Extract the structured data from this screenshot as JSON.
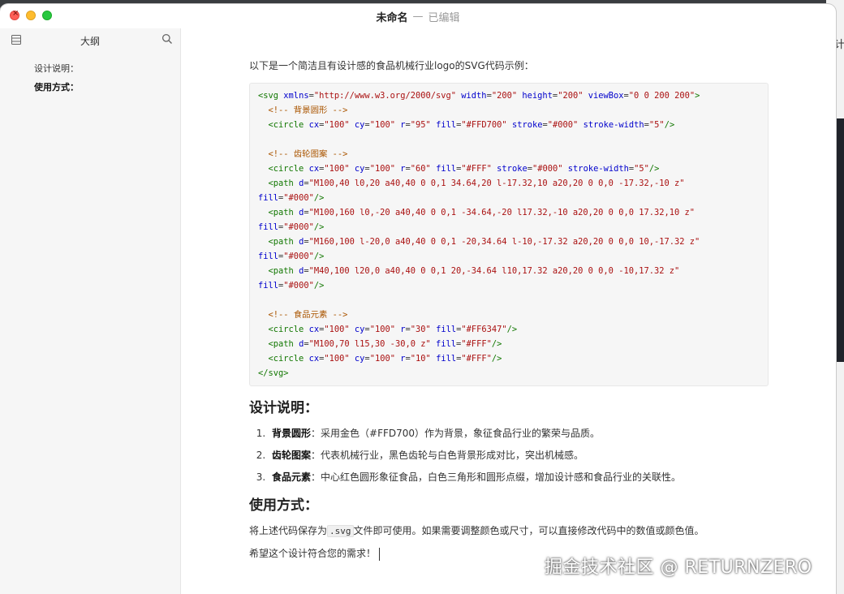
{
  "window": {
    "title": "未命名",
    "separator": "—",
    "status": "已编辑"
  },
  "sidebar": {
    "title": "大纲",
    "items": [
      {
        "label": "设计说明："
      },
      {
        "label": "使用方式："
      }
    ]
  },
  "document": {
    "intro": "以下是一个简洁且有设计感的食品机械行业logo的SVG代码示例：",
    "code_lines": [
      [
        {
          "t": "tag",
          "v": "<svg"
        },
        {
          "t": "p",
          "v": " "
        },
        {
          "t": "attr",
          "v": "xmlns"
        },
        {
          "t": "p",
          "v": "="
        },
        {
          "t": "str",
          "v": "\"http://www.w3.org/2000/svg\""
        },
        {
          "t": "p",
          "v": " "
        },
        {
          "t": "attr",
          "v": "width"
        },
        {
          "t": "p",
          "v": "="
        },
        {
          "t": "str",
          "v": "\"200\""
        },
        {
          "t": "p",
          "v": " "
        },
        {
          "t": "attr",
          "v": "height"
        },
        {
          "t": "p",
          "v": "="
        },
        {
          "t": "str",
          "v": "\"200\""
        },
        {
          "t": "p",
          "v": " "
        },
        {
          "t": "attr",
          "v": "viewBox"
        },
        {
          "t": "p",
          "v": "="
        },
        {
          "t": "str",
          "v": "\"0 0 200 200\""
        },
        {
          "t": "tag",
          "v": ">"
        }
      ],
      [
        {
          "t": "p",
          "v": "  "
        },
        {
          "t": "comment",
          "v": "<!-- 背景圆形 -->"
        }
      ],
      [
        {
          "t": "p",
          "v": "  "
        },
        {
          "t": "tag",
          "v": "<circle"
        },
        {
          "t": "p",
          "v": " "
        },
        {
          "t": "attr",
          "v": "cx"
        },
        {
          "t": "p",
          "v": "="
        },
        {
          "t": "str",
          "v": "\"100\""
        },
        {
          "t": "p",
          "v": " "
        },
        {
          "t": "attr",
          "v": "cy"
        },
        {
          "t": "p",
          "v": "="
        },
        {
          "t": "str",
          "v": "\"100\""
        },
        {
          "t": "p",
          "v": " "
        },
        {
          "t": "attr",
          "v": "r"
        },
        {
          "t": "p",
          "v": "="
        },
        {
          "t": "str",
          "v": "\"95\""
        },
        {
          "t": "p",
          "v": " "
        },
        {
          "t": "attr",
          "v": "fill"
        },
        {
          "t": "p",
          "v": "="
        },
        {
          "t": "str",
          "v": "\"#FFD700\""
        },
        {
          "t": "p",
          "v": " "
        },
        {
          "t": "attr",
          "v": "stroke"
        },
        {
          "t": "p",
          "v": "="
        },
        {
          "t": "str",
          "v": "\"#000\""
        },
        {
          "t": "p",
          "v": " "
        },
        {
          "t": "attr",
          "v": "stroke-width"
        },
        {
          "t": "p",
          "v": "="
        },
        {
          "t": "str",
          "v": "\"5\""
        },
        {
          "t": "tag",
          "v": "/>"
        }
      ],
      [],
      [
        {
          "t": "p",
          "v": "  "
        },
        {
          "t": "comment",
          "v": "<!-- 齿轮图案 -->"
        }
      ],
      [
        {
          "t": "p",
          "v": "  "
        },
        {
          "t": "tag",
          "v": "<circle"
        },
        {
          "t": "p",
          "v": " "
        },
        {
          "t": "attr",
          "v": "cx"
        },
        {
          "t": "p",
          "v": "="
        },
        {
          "t": "str",
          "v": "\"100\""
        },
        {
          "t": "p",
          "v": " "
        },
        {
          "t": "attr",
          "v": "cy"
        },
        {
          "t": "p",
          "v": "="
        },
        {
          "t": "str",
          "v": "\"100\""
        },
        {
          "t": "p",
          "v": " "
        },
        {
          "t": "attr",
          "v": "r"
        },
        {
          "t": "p",
          "v": "="
        },
        {
          "t": "str",
          "v": "\"60\""
        },
        {
          "t": "p",
          "v": " "
        },
        {
          "t": "attr",
          "v": "fill"
        },
        {
          "t": "p",
          "v": "="
        },
        {
          "t": "str",
          "v": "\"#FFF\""
        },
        {
          "t": "p",
          "v": " "
        },
        {
          "t": "attr",
          "v": "stroke"
        },
        {
          "t": "p",
          "v": "="
        },
        {
          "t": "str",
          "v": "\"#000\""
        },
        {
          "t": "p",
          "v": " "
        },
        {
          "t": "attr",
          "v": "stroke-width"
        },
        {
          "t": "p",
          "v": "="
        },
        {
          "t": "str",
          "v": "\"5\""
        },
        {
          "t": "tag",
          "v": "/>"
        }
      ],
      [
        {
          "t": "p",
          "v": "  "
        },
        {
          "t": "tag",
          "v": "<path"
        },
        {
          "t": "p",
          "v": " "
        },
        {
          "t": "attr",
          "v": "d"
        },
        {
          "t": "p",
          "v": "="
        },
        {
          "t": "str",
          "v": "\"M100,40 l0,20 a40,40 0 0,1 34.64,20 l-17.32,10 a20,20 0 0,0 -17.32,-10 z\""
        }
      ],
      [
        {
          "t": "attr",
          "v": "fill"
        },
        {
          "t": "p",
          "v": "="
        },
        {
          "t": "str",
          "v": "\"#000\""
        },
        {
          "t": "tag",
          "v": "/>"
        }
      ],
      [
        {
          "t": "p",
          "v": "  "
        },
        {
          "t": "tag",
          "v": "<path"
        },
        {
          "t": "p",
          "v": " "
        },
        {
          "t": "attr",
          "v": "d"
        },
        {
          "t": "p",
          "v": "="
        },
        {
          "t": "str",
          "v": "\"M100,160 l0,-20 a40,40 0 0,1 -34.64,-20 l17.32,-10 a20,20 0 0,0 17.32,10 z\""
        }
      ],
      [
        {
          "t": "attr",
          "v": "fill"
        },
        {
          "t": "p",
          "v": "="
        },
        {
          "t": "str",
          "v": "\"#000\""
        },
        {
          "t": "tag",
          "v": "/>"
        }
      ],
      [
        {
          "t": "p",
          "v": "  "
        },
        {
          "t": "tag",
          "v": "<path"
        },
        {
          "t": "p",
          "v": " "
        },
        {
          "t": "attr",
          "v": "d"
        },
        {
          "t": "p",
          "v": "="
        },
        {
          "t": "str",
          "v": "\"M160,100 l-20,0 a40,40 0 0,1 -20,34.64 l-10,-17.32 a20,20 0 0,0 10,-17.32 z\""
        }
      ],
      [
        {
          "t": "attr",
          "v": "fill"
        },
        {
          "t": "p",
          "v": "="
        },
        {
          "t": "str",
          "v": "\"#000\""
        },
        {
          "t": "tag",
          "v": "/>"
        }
      ],
      [
        {
          "t": "p",
          "v": "  "
        },
        {
          "t": "tag",
          "v": "<path"
        },
        {
          "t": "p",
          "v": " "
        },
        {
          "t": "attr",
          "v": "d"
        },
        {
          "t": "p",
          "v": "="
        },
        {
          "t": "str",
          "v": "\"M40,100 l20,0 a40,40 0 0,1 20,-34.64 l10,17.32 a20,20 0 0,0 -10,17.32 z\""
        }
      ],
      [
        {
          "t": "attr",
          "v": "fill"
        },
        {
          "t": "p",
          "v": "="
        },
        {
          "t": "str",
          "v": "\"#000\""
        },
        {
          "t": "tag",
          "v": "/>"
        }
      ],
      [],
      [
        {
          "t": "p",
          "v": "  "
        },
        {
          "t": "comment",
          "v": "<!-- 食品元素 -->"
        }
      ],
      [
        {
          "t": "p",
          "v": "  "
        },
        {
          "t": "tag",
          "v": "<circle"
        },
        {
          "t": "p",
          "v": " "
        },
        {
          "t": "attr",
          "v": "cx"
        },
        {
          "t": "p",
          "v": "="
        },
        {
          "t": "str",
          "v": "\"100\""
        },
        {
          "t": "p",
          "v": " "
        },
        {
          "t": "attr",
          "v": "cy"
        },
        {
          "t": "p",
          "v": "="
        },
        {
          "t": "str",
          "v": "\"100\""
        },
        {
          "t": "p",
          "v": " "
        },
        {
          "t": "attr",
          "v": "r"
        },
        {
          "t": "p",
          "v": "="
        },
        {
          "t": "str",
          "v": "\"30\""
        },
        {
          "t": "p",
          "v": " "
        },
        {
          "t": "attr",
          "v": "fill"
        },
        {
          "t": "p",
          "v": "="
        },
        {
          "t": "str",
          "v": "\"#FF6347\""
        },
        {
          "t": "tag",
          "v": "/>"
        }
      ],
      [
        {
          "t": "p",
          "v": "  "
        },
        {
          "t": "tag",
          "v": "<path"
        },
        {
          "t": "p",
          "v": " "
        },
        {
          "t": "attr",
          "v": "d"
        },
        {
          "t": "p",
          "v": "="
        },
        {
          "t": "str",
          "v": "\"M100,70 l15,30 -30,0 z\""
        },
        {
          "t": "p",
          "v": " "
        },
        {
          "t": "attr",
          "v": "fill"
        },
        {
          "t": "p",
          "v": "="
        },
        {
          "t": "str",
          "v": "\"#FFF\""
        },
        {
          "t": "tag",
          "v": "/>"
        }
      ],
      [
        {
          "t": "p",
          "v": "  "
        },
        {
          "t": "tag",
          "v": "<circle"
        },
        {
          "t": "p",
          "v": " "
        },
        {
          "t": "attr",
          "v": "cx"
        },
        {
          "t": "p",
          "v": "="
        },
        {
          "t": "str",
          "v": "\"100\""
        },
        {
          "t": "p",
          "v": " "
        },
        {
          "t": "attr",
          "v": "cy"
        },
        {
          "t": "p",
          "v": "="
        },
        {
          "t": "str",
          "v": "\"100\""
        },
        {
          "t": "p",
          "v": " "
        },
        {
          "t": "attr",
          "v": "r"
        },
        {
          "t": "p",
          "v": "="
        },
        {
          "t": "str",
          "v": "\"10\""
        },
        {
          "t": "p",
          "v": " "
        },
        {
          "t": "attr",
          "v": "fill"
        },
        {
          "t": "p",
          "v": "="
        },
        {
          "t": "str",
          "v": "\"#FFF\""
        },
        {
          "t": "tag",
          "v": "/>"
        }
      ],
      [
        {
          "t": "tag",
          "v": "</svg>"
        }
      ]
    ],
    "design_heading": "设计说明：",
    "design_items": [
      {
        "term": "背景圆形",
        "colon": "：",
        "desc": "采用金色（#FFD700）作为背景，象征食品行业的繁荣与品质。"
      },
      {
        "term": "齿轮图案",
        "colon": "：",
        "desc": "代表机械行业，黑色齿轮与白色背景形成对比，突出机械感。"
      },
      {
        "term": "食品元素",
        "colon": "：",
        "desc": "中心红色圆形象征食品，白色三角形和圆形点缀，增加设计感和食品行业的关联性。"
      }
    ],
    "usage_heading": "使用方式：",
    "usage_text_before": "将上述代码保存为",
    "usage_code": ".svg",
    "usage_text_after": "文件即可使用。如果需要调整颜色或尺寸，可以直接修改代码中的数值或颜色值。",
    "closing": "希望这个设计符合您的需求！"
  },
  "watermark": "掘金技术社区 @ RETURNZERO",
  "background_window_text": "计",
  "colors": {
    "close": "#fe5f57",
    "minimize": "#febc2e",
    "maximize": "#28c840",
    "code_tag": "#117700",
    "code_attr": "#0000cc",
    "code_string": "#aa1111",
    "code_comment": "#aa5500"
  }
}
